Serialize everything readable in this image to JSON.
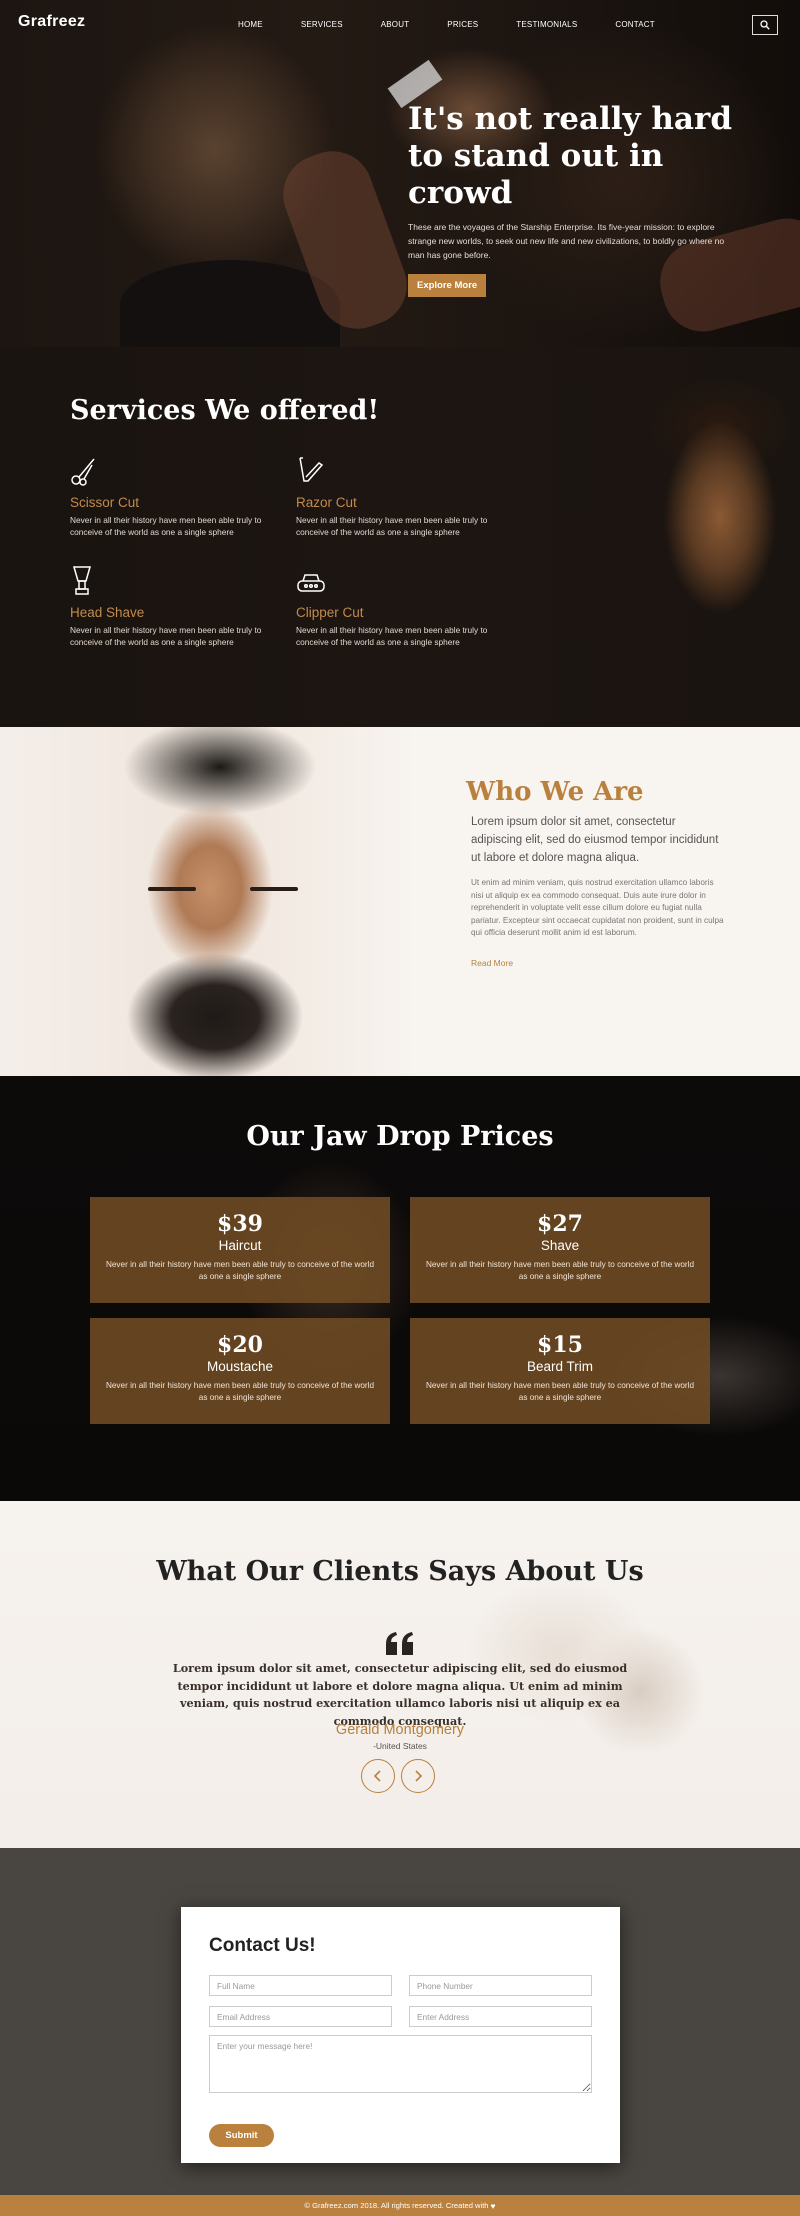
{
  "nav": {
    "logo": "Grafreez",
    "items": [
      "HOME",
      "SERVICES",
      "ABOUT",
      "PRICES",
      "TESTIMONIALS",
      "CONTACT"
    ]
  },
  "hero": {
    "title": "It's not really hard to stand out in crowd",
    "description": "These are the voyages of the Starship Enterprise. Its five-year mission: to explore strange new worlds, to seek out new life and new civilizations, to boldly go where no man has gone before.",
    "button": "Explore More"
  },
  "services": {
    "title": "Services We offered!",
    "items": [
      {
        "title": "Scissor Cut",
        "desc": "Never in all their history have men been able truly to conceive of the world as one a single sphere",
        "icon": "scissors-icon"
      },
      {
        "title": "Razor Cut",
        "desc": "Never in all their history have men been able truly to conceive of the world as one a single sphere",
        "icon": "razor-icon"
      },
      {
        "title": "Head Shave",
        "desc": "Never in all their history have men been able truly to conceive of the world as one a single sphere",
        "icon": "shaving-brush-icon"
      },
      {
        "title": "Clipper Cut",
        "desc": "Never in all their history have men been able truly to conceive of the world as one a single sphere",
        "icon": "clipper-icon"
      }
    ]
  },
  "about": {
    "title": "Who We Are",
    "lead": "Lorem ipsum dolor sit amet, consectetur adipiscing elit, sed do eiusmod tempor incididunt ut labore et dolore magna aliqua.",
    "body": "Ut enim ad minim veniam, quis nostrud exercitation ullamco laboris nisi ut aliquip ex ea commodo consequat. Duis aute irure dolor in reprehenderit in voluptate velit esse cillum dolore eu fugiat nulla pariatur. Excepteur sint occaecat cupidatat non proident, sunt in culpa qui officia deserunt mollit anim id est laborum.",
    "link": "Read More"
  },
  "prices": {
    "title": "Our Jaw Drop Prices",
    "items": [
      {
        "amount": "$39",
        "name": "Haircut",
        "desc": "Never in all their history have men been able truly to conceive of the world as one a single sphere"
      },
      {
        "amount": "$27",
        "name": "Shave",
        "desc": "Never in all their history have men been able truly to conceive of the world as one a single sphere"
      },
      {
        "amount": "$20",
        "name": "Moustache",
        "desc": "Never in all their history have men been able truly to conceive of the world as one a single sphere"
      },
      {
        "amount": "$15",
        "name": "Beard Trim",
        "desc": "Never in all their history have men been able truly to conceive of the world as one a single sphere"
      }
    ]
  },
  "testimonials": {
    "title": "What Our Clients Says About Us",
    "quote": "Lorem ipsum dolor sit amet, consectetur adipiscing elit, sed do eiusmod tempor incididunt ut labore et dolore magna aliqua. Ut enim ad minim veniam, quis nostrud exercitation ullamco laboris nisi ut aliquip ex ea commodo consequat.",
    "name": "Gerald Montgomery",
    "location": "-United States"
  },
  "contact": {
    "title": "Contact Us!",
    "full_name_placeholder": "Full Name",
    "phone_placeholder": "Phone Number",
    "email_placeholder": "Email Address",
    "address_placeholder": "Enter Address",
    "message_placeholder": "Enter your message here!",
    "submit": "Submit"
  },
  "footer": {
    "text": "© Grafreez.com 2018. All rights reserved. Created with"
  },
  "colors": {
    "accent": "#b9813d",
    "dark": "#1c1511",
    "contact_bg": "#494541"
  }
}
